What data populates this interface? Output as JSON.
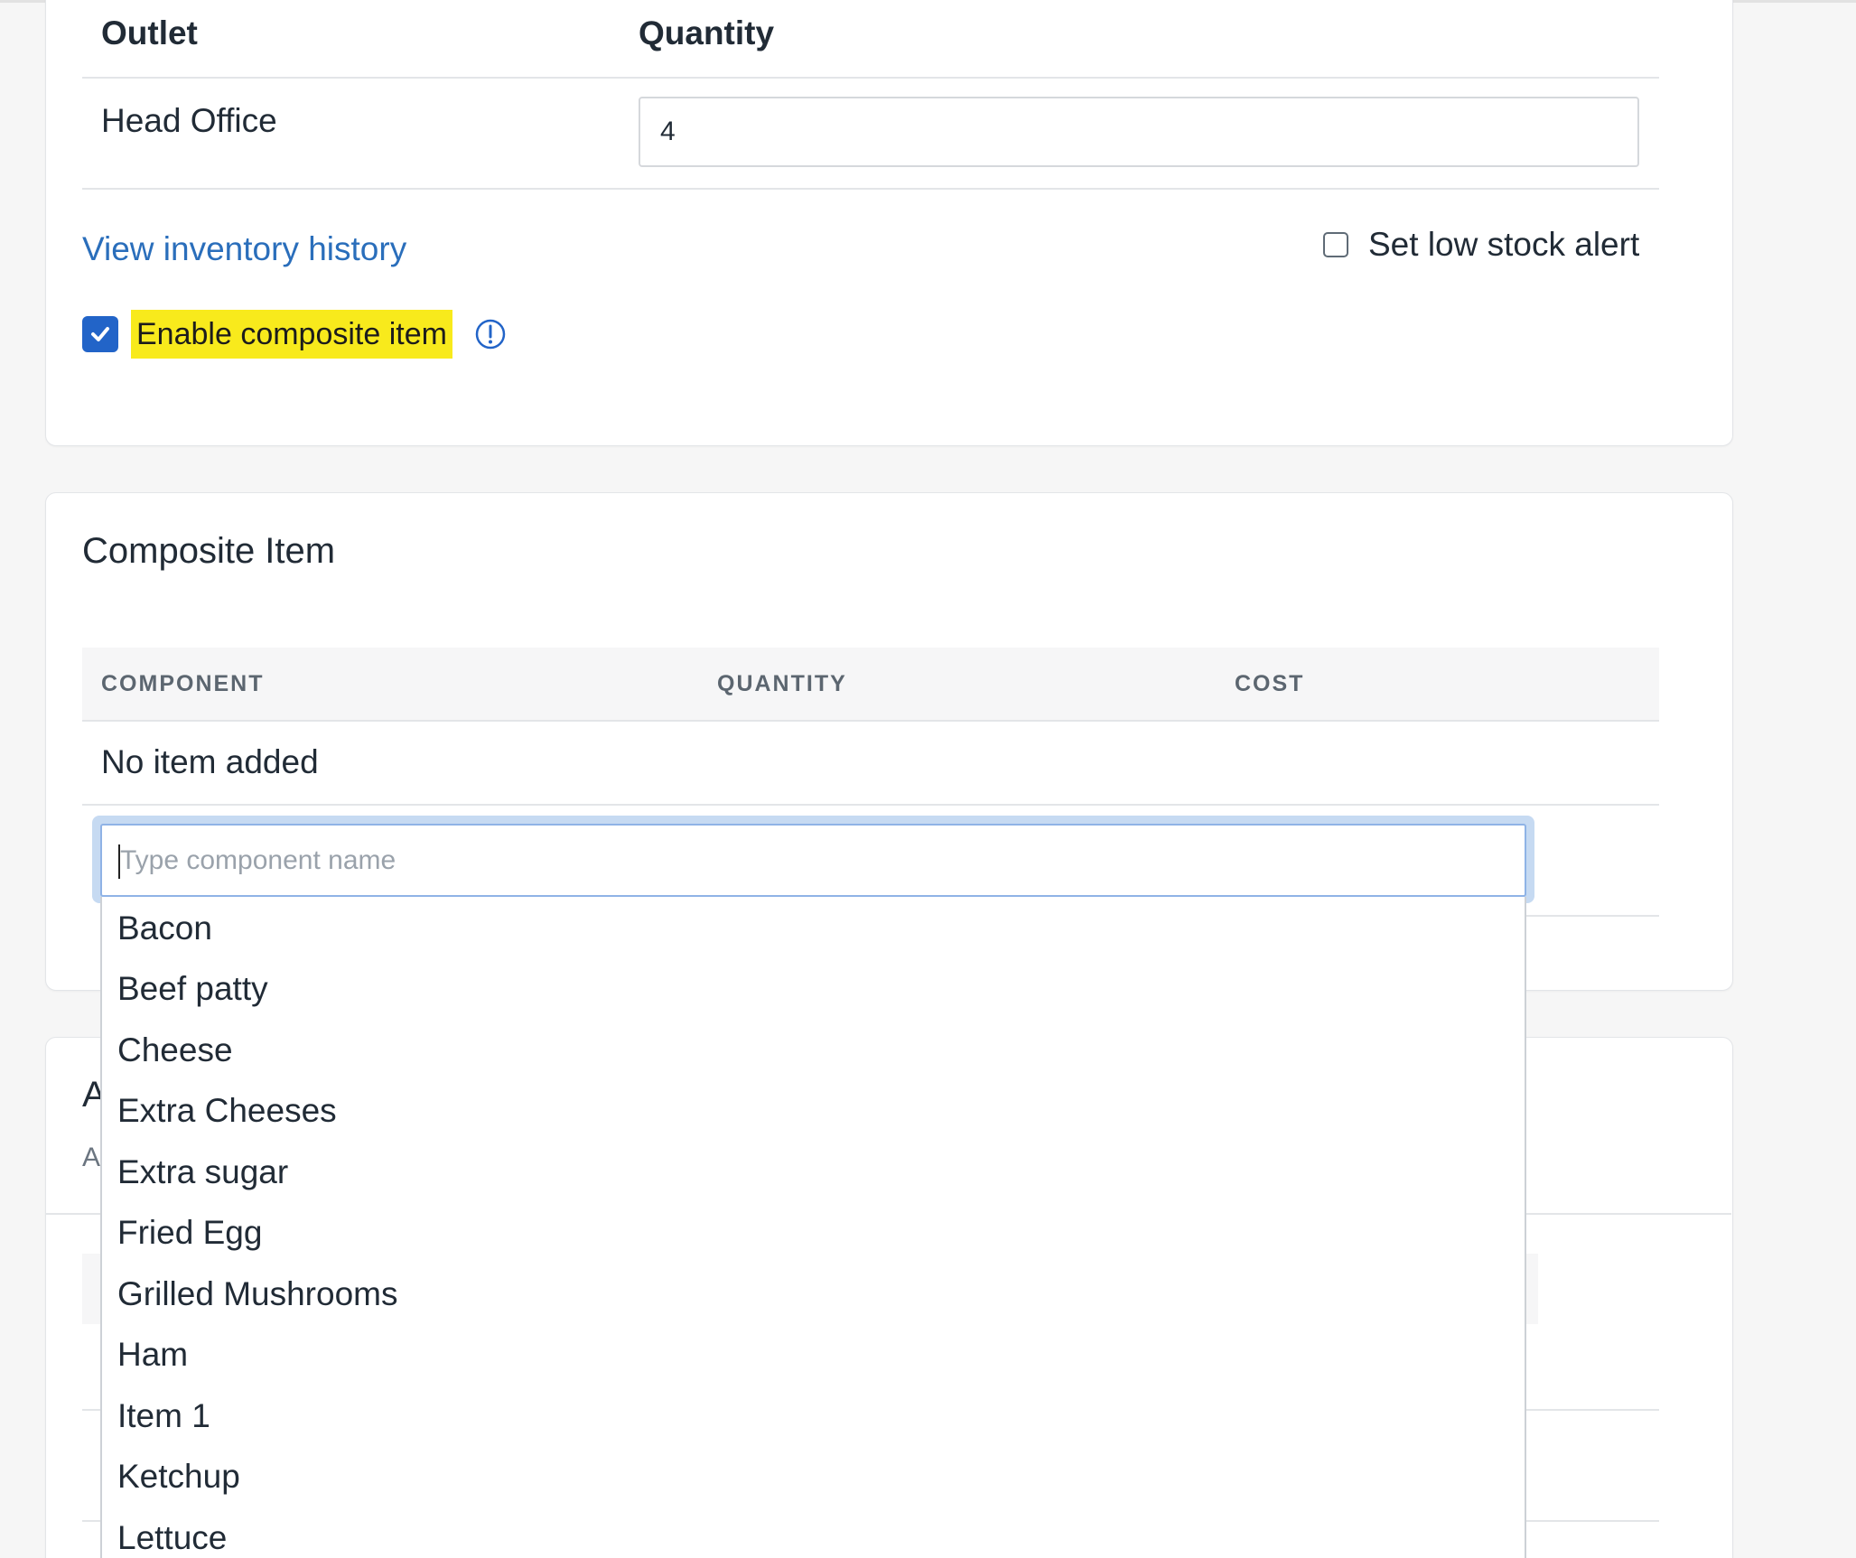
{
  "inventory": {
    "headers": {
      "outlet": "Outlet",
      "quantity": "Quantity"
    },
    "rows": [
      {
        "outlet": "Head Office",
        "quantity": "4"
      }
    ],
    "history_link": "View inventory history",
    "low_stock_label": "Set low stock alert",
    "low_stock_checked": false,
    "composite_label": "Enable composite item",
    "composite_checked": true
  },
  "composite": {
    "title": "Composite Item",
    "columns": [
      "COMPONENT",
      "QUANTITY",
      "COST"
    ],
    "empty_text": "No item added",
    "input_placeholder": "Type component name",
    "suggestions": [
      "Bacon",
      "Beef patty",
      "Cheese",
      "Extra Cheeses",
      "Extra sugar",
      "Fried Egg",
      "Grilled Mushrooms",
      "Ham",
      "Item 1",
      "Ketchup",
      "Lettuce"
    ]
  },
  "next_card": {
    "title_fragment": "A",
    "subtitle_fragment": "A"
  },
  "colors": {
    "link": "#2a6ebb",
    "checkbox": "#2264c8",
    "highlight": "#f8ea1c",
    "focus_ring": "#c6daf2"
  }
}
